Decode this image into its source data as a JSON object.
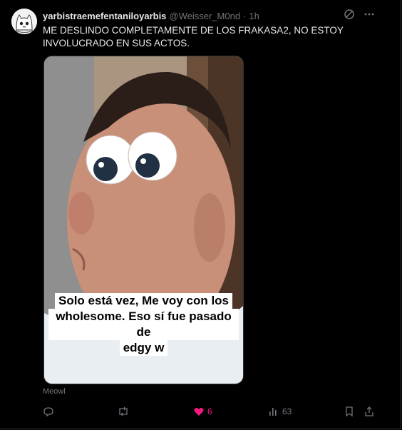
{
  "tweet": {
    "display_name": "yarbistraemefentaniloyarbis",
    "handle": "@Weisser_M0nd",
    "separator": "·",
    "time": "1h",
    "text": "ME DESLINDO COMPLETAMENTE DE LOS FRAKASA2, NO ESTOY INVOLUCRADO EN SUS ACTOS.",
    "media": {
      "caption_lines": [
        "Solo está vez, Me voy con los",
        "wholesome. Eso sí fue pasado de",
        "edgy w"
      ]
    },
    "source_label": "Meowl"
  },
  "icons": {
    "avatar": "cat-avatar",
    "grok": "grok-icon",
    "more": "more-icon",
    "reply": "reply-icon",
    "repost": "repost-icon",
    "like": "heart-icon",
    "views": "views-icon",
    "bookmark": "bookmark-icon",
    "share": "share-icon"
  },
  "actions": {
    "reply_count": "",
    "repost_count": "",
    "like_count": "6",
    "views_count": "63"
  },
  "colors": {
    "background": "#000000",
    "text": "#e7e9ea",
    "muted": "#71767b",
    "like_active": "#f91880",
    "border": "#2f3336"
  }
}
